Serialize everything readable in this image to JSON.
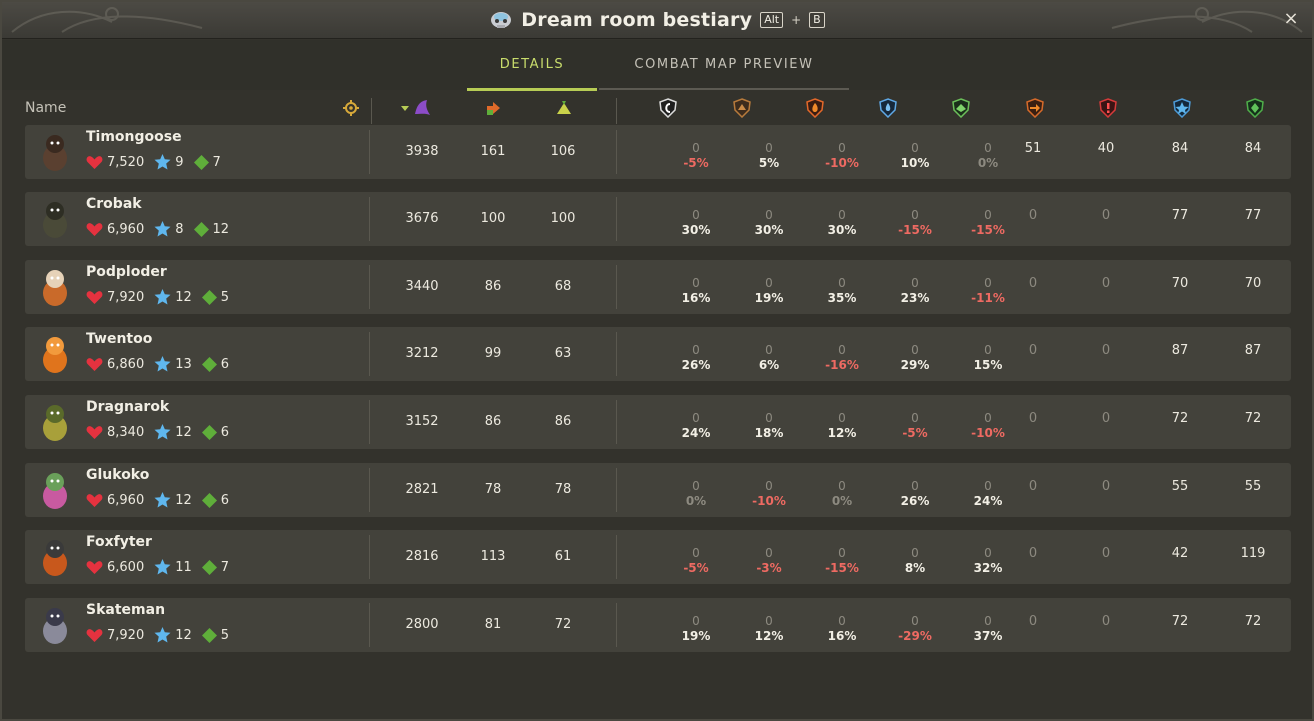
{
  "window": {
    "title": "Dream room bestiary",
    "shortcut": [
      "Alt",
      "B"
    ],
    "shortcut_join": "+",
    "close": "×"
  },
  "tabs": [
    {
      "label": "DETAILS",
      "active": true
    },
    {
      "label": "COMBAT MAP PREVIEW",
      "active": false
    }
  ],
  "columns": {
    "name_label": "Name",
    "icons": [
      "locate-icon",
      "sort-level-icon",
      "ap-icon",
      "mp-icon",
      "neutral-res-icon",
      "earth-res-icon",
      "fire-res-icon",
      "water-res-icon",
      "air-res-icon",
      "push-damage-icon",
      "crit-res-icon",
      "ap-dodge-icon",
      "mp-dodge-icon"
    ]
  },
  "colors": {
    "accent": "#c9dd6c",
    "negative": "#ee6a62",
    "row_bg": "#43423b",
    "window_bg": "#33322c"
  },
  "monsters": [
    {
      "name": "Timongoose",
      "hp": "7,520",
      "ap": "9",
      "mp": "7",
      "level": "3938",
      "col2": "161",
      "col3": "106",
      "res": [
        {
          "base": "0",
          "pct": "-5%",
          "sign": "neg"
        },
        {
          "base": "0",
          "pct": "5%",
          "sign": "pos"
        },
        {
          "base": "0",
          "pct": "-10%",
          "sign": "neg"
        },
        {
          "base": "0",
          "pct": "10%",
          "sign": "pos"
        },
        {
          "base": "0",
          "pct": "0%",
          "sign": "zero"
        }
      ],
      "extra": [
        "51",
        "40",
        "84",
        "84"
      ]
    },
    {
      "name": "Crobak",
      "hp": "6,960",
      "ap": "8",
      "mp": "12",
      "level": "3676",
      "col2": "100",
      "col3": "100",
      "res": [
        {
          "base": "0",
          "pct": "30%",
          "sign": "pos"
        },
        {
          "base": "0",
          "pct": "30%",
          "sign": "pos"
        },
        {
          "base": "0",
          "pct": "30%",
          "sign": "pos"
        },
        {
          "base": "0",
          "pct": "-15%",
          "sign": "neg"
        },
        {
          "base": "0",
          "pct": "-15%",
          "sign": "neg"
        }
      ],
      "extra": [
        "0",
        "0",
        "77",
        "77"
      ]
    },
    {
      "name": "Podploder",
      "hp": "7,920",
      "ap": "12",
      "mp": "5",
      "level": "3440",
      "col2": "86",
      "col3": "68",
      "res": [
        {
          "base": "0",
          "pct": "16%",
          "sign": "pos"
        },
        {
          "base": "0",
          "pct": "19%",
          "sign": "pos"
        },
        {
          "base": "0",
          "pct": "35%",
          "sign": "pos"
        },
        {
          "base": "0",
          "pct": "23%",
          "sign": "pos"
        },
        {
          "base": "0",
          "pct": "-11%",
          "sign": "neg"
        }
      ],
      "extra": [
        "0",
        "0",
        "70",
        "70"
      ]
    },
    {
      "name": "Twentoo",
      "hp": "6,860",
      "ap": "13",
      "mp": "6",
      "level": "3212",
      "col2": "99",
      "col3": "63",
      "res": [
        {
          "base": "0",
          "pct": "26%",
          "sign": "pos"
        },
        {
          "base": "0",
          "pct": "6%",
          "sign": "pos"
        },
        {
          "base": "0",
          "pct": "-16%",
          "sign": "neg"
        },
        {
          "base": "0",
          "pct": "29%",
          "sign": "pos"
        },
        {
          "base": "0",
          "pct": "15%",
          "sign": "pos"
        }
      ],
      "extra": [
        "0",
        "0",
        "87",
        "87"
      ]
    },
    {
      "name": "Dragnarok",
      "hp": "8,340",
      "ap": "12",
      "mp": "6",
      "level": "3152",
      "col2": "86",
      "col3": "86",
      "res": [
        {
          "base": "0",
          "pct": "24%",
          "sign": "pos"
        },
        {
          "base": "0",
          "pct": "18%",
          "sign": "pos"
        },
        {
          "base": "0",
          "pct": "12%",
          "sign": "pos"
        },
        {
          "base": "0",
          "pct": "-5%",
          "sign": "neg"
        },
        {
          "base": "0",
          "pct": "-10%",
          "sign": "neg"
        }
      ],
      "extra": [
        "0",
        "0",
        "72",
        "72"
      ]
    },
    {
      "name": "Glukoko",
      "hp": "6,960",
      "ap": "12",
      "mp": "6",
      "level": "2821",
      "col2": "78",
      "col3": "78",
      "res": [
        {
          "base": "0",
          "pct": "0%",
          "sign": "zero"
        },
        {
          "base": "0",
          "pct": "-10%",
          "sign": "neg"
        },
        {
          "base": "0",
          "pct": "0%",
          "sign": "zero"
        },
        {
          "base": "0",
          "pct": "26%",
          "sign": "pos"
        },
        {
          "base": "0",
          "pct": "24%",
          "sign": "pos"
        }
      ],
      "extra": [
        "0",
        "0",
        "55",
        "55"
      ]
    },
    {
      "name": "Foxfyter",
      "hp": "6,600",
      "ap": "11",
      "mp": "7",
      "level": "2816",
      "col2": "113",
      "col3": "61",
      "res": [
        {
          "base": "0",
          "pct": "-5%",
          "sign": "neg"
        },
        {
          "base": "0",
          "pct": "-3%",
          "sign": "neg"
        },
        {
          "base": "0",
          "pct": "-15%",
          "sign": "neg"
        },
        {
          "base": "0",
          "pct": "8%",
          "sign": "pos"
        },
        {
          "base": "0",
          "pct": "32%",
          "sign": "pos"
        }
      ],
      "extra": [
        "0",
        "0",
        "42",
        "119"
      ]
    },
    {
      "name": "Skateman",
      "hp": "7,920",
      "ap": "12",
      "mp": "5",
      "level": "2800",
      "col2": "81",
      "col3": "72",
      "res": [
        {
          "base": "0",
          "pct": "19%",
          "sign": "pos"
        },
        {
          "base": "0",
          "pct": "12%",
          "sign": "pos"
        },
        {
          "base": "0",
          "pct": "16%",
          "sign": "pos"
        },
        {
          "base": "0",
          "pct": "-29%",
          "sign": "neg"
        },
        {
          "base": "0",
          "pct": "37%",
          "sign": "pos"
        }
      ],
      "extra": [
        "0",
        "0",
        "72",
        "72"
      ]
    }
  ]
}
